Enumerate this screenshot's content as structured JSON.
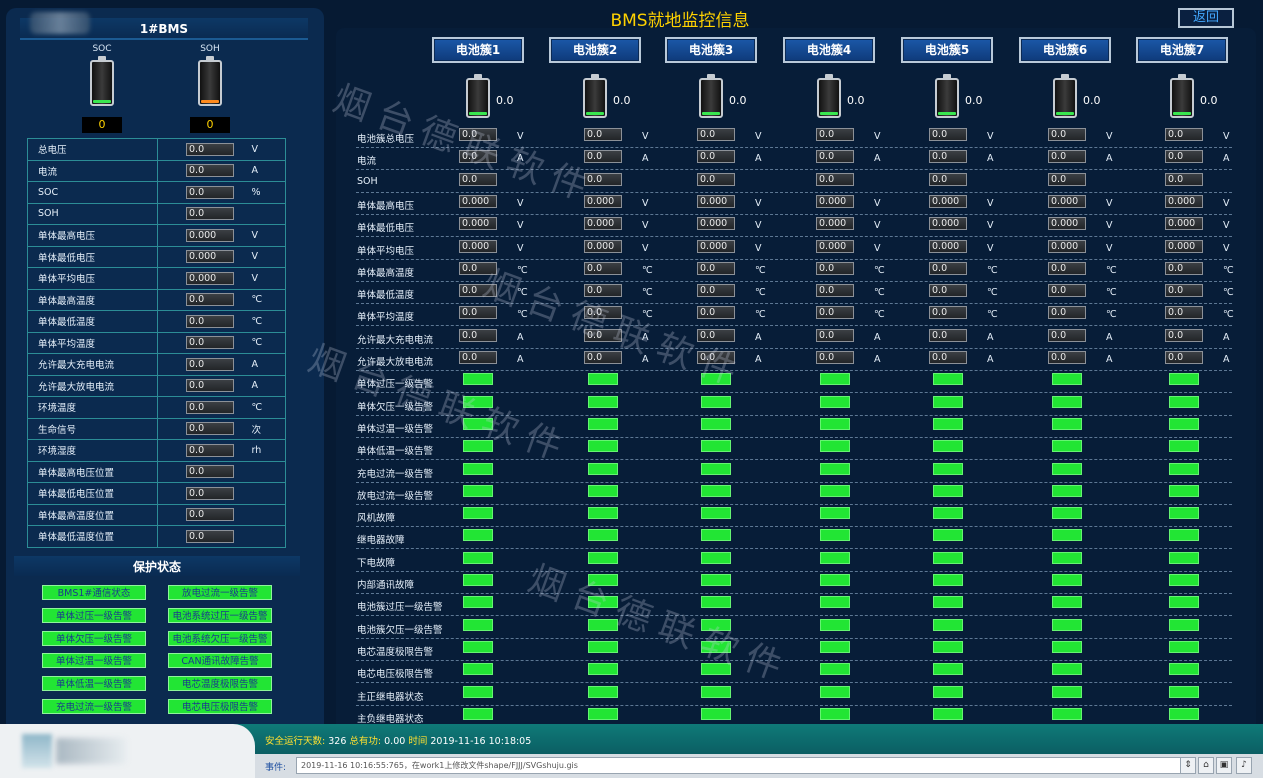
{
  "header": {
    "title": "BMS就地监控信息",
    "back_label": "返回"
  },
  "left": {
    "title": "1#BMS",
    "gauges": [
      {
        "label": "SOC",
        "value": "0"
      },
      {
        "label": "SOH",
        "value": "0"
      }
    ],
    "rows": [
      {
        "name": "总电压",
        "value": "0.0",
        "unit": "V"
      },
      {
        "name": "电流",
        "value": "0.0",
        "unit": "A"
      },
      {
        "name": "SOC",
        "value": "0.0",
        "unit": "%"
      },
      {
        "name": "SOH",
        "value": "0.0",
        "unit": ""
      },
      {
        "name": "单体最高电压",
        "value": "0.000",
        "unit": "V"
      },
      {
        "name": "单体最低电压",
        "value": "0.000",
        "unit": "V"
      },
      {
        "name": "单体平均电压",
        "value": "0.000",
        "unit": "V"
      },
      {
        "name": "单体最高温度",
        "value": "0.0",
        "unit": "℃"
      },
      {
        "name": "单体最低温度",
        "value": "0.0",
        "unit": "℃"
      },
      {
        "name": "单体平均温度",
        "value": "0.0",
        "unit": "℃"
      },
      {
        "name": "允许最大充电电流",
        "value": "0.0",
        "unit": "A"
      },
      {
        "name": "允许最大放电电流",
        "value": "0.0",
        "unit": "A"
      },
      {
        "name": "环境温度",
        "value": "0.0",
        "unit": "℃"
      },
      {
        "name": "生命信号",
        "value": "0.0",
        "unit": "次"
      },
      {
        "name": "环境湿度",
        "value": "0.0",
        "unit": "rh"
      },
      {
        "name": "单体最高电压位置",
        "value": "0.0",
        "unit": ""
      },
      {
        "name": "单体最低电压位置",
        "value": "0.0",
        "unit": ""
      },
      {
        "name": "单体最高温度位置",
        "value": "0.0",
        "unit": ""
      },
      {
        "name": "单体最低温度位置",
        "value": "0.0",
        "unit": ""
      }
    ],
    "protect_title": "保护状态",
    "protect_items": [
      "BMS1#通信状态",
      "放电过流一级告警",
      "单体过压一级告警",
      "电池系统过压一级告警",
      "单体欠压一级告警",
      "电池系统欠压一级告警",
      "单体过温一级告警",
      "CAN通讯故障告警",
      "单体低温一级告警",
      "电芯温度极限告警",
      "充电过流一级告警",
      "电芯电压极限告警"
    ]
  },
  "clusters": {
    "tabs": [
      "电池簇1",
      "电池簇2",
      "电池簇3",
      "电池簇4",
      "电池簇5",
      "电池簇6",
      "电池簇7"
    ],
    "battery_values": [
      "0.0",
      "0.0",
      "0.0",
      "0.0",
      "0.0",
      "0.0",
      "0.0"
    ],
    "value_rows": [
      {
        "label": "电池簇总电压",
        "value": "0.0",
        "unit": "V"
      },
      {
        "label": "电流",
        "value": "0.0",
        "unit": "A"
      },
      {
        "label": "SOH",
        "value": "0.0",
        "unit": ""
      },
      {
        "label": "单体最高电压",
        "value": "0.000",
        "unit": "V"
      },
      {
        "label": "单体最低电压",
        "value": "0.000",
        "unit": "V"
      },
      {
        "label": "单体平均电压",
        "value": "0.000",
        "unit": "V"
      },
      {
        "label": "单体最高温度",
        "value": "0.0",
        "unit": "℃"
      },
      {
        "label": "单体最低温度",
        "value": "0.0",
        "unit": "℃"
      },
      {
        "label": "单体平均温度",
        "value": "0.0",
        "unit": "℃"
      },
      {
        "label": "允许最大充电电流",
        "value": "0.0",
        "unit": "A"
      },
      {
        "label": "允许最大放电电流",
        "value": "0.0",
        "unit": "A"
      }
    ],
    "status_rows": [
      "单体过压一级告警",
      "单体欠压一级告警",
      "单体过温一级告警",
      "单体低温一级告警",
      "充电过流一级告警",
      "放电过流一级告警",
      "风机故障",
      "继电器故障",
      "下电故障",
      "内部通讯故障",
      "电池簇过压一级告警",
      "电池簇欠压一级告警",
      "电芯温度极限告警",
      "电芯电压极限告警",
      "主正继电器状态",
      "主负继电器状态"
    ],
    "status_color": "#22e534"
  },
  "watermark": "烟台德联软件",
  "footer": {
    "safe_days_label": "安全运行天数:",
    "safe_days_value": "326",
    "total_power_label": "总有功:",
    "total_power_value": "0.00",
    "time_label": "时间",
    "time_value": "2019-11-16 10:18:05",
    "event_label": "事件:",
    "event_text": "2019-11-16  10:16:55:765，在work1上修改文件shape/FJJJ/SVGshuju.gis"
  },
  "colors": {
    "accent_yellow": "#ffd200",
    "led_green": "#22e534",
    "back_blue": "#43a9ff"
  }
}
